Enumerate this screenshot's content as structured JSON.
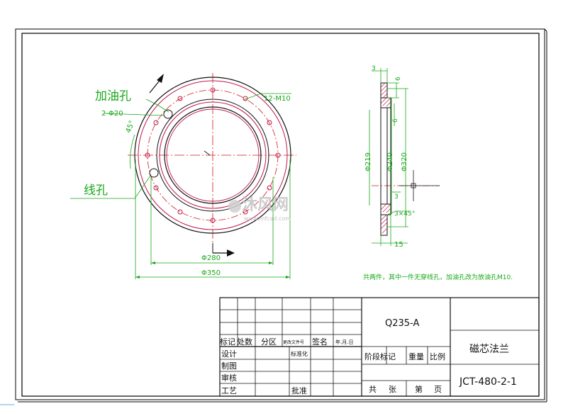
{
  "drawing": {
    "labels": {
      "oil_hole": "加油孔",
      "wire_hole": "线孔",
      "hole_2": "2-Φ20",
      "hole_12": "12-M10",
      "angle": "45°",
      "d280": "Φ280",
      "d350": "Φ350",
      "d219": "Φ219",
      "d240": "Φ240",
      "d320": "Φ320",
      "dim_3_top": "3",
      "dim_6_top": "6",
      "dim_6_mid": "6",
      "dim_3_mid": "3",
      "dim_chamfer": "3×45°",
      "dim_15": "15"
    },
    "note": "共两件，其中一件无穿线孔，加油孔改为放油孔M10.",
    "watermark": {
      "name": "沐风网",
      "url": "www.mfcad.com"
    }
  },
  "title_block": {
    "material": "Q235-A",
    "part_name": "磁芯法兰",
    "drawing_no": "JCT-480-2-1",
    "row_labels": {
      "mark": "标记",
      "count": "处数",
      "zone": "分区",
      "change_doc": "更改文件号",
      "sign": "签名",
      "date": "年.月.日",
      "design": "设计",
      "standard": "标准化",
      "draft": "制图",
      "review": "审核",
      "process": "工艺",
      "approve": "批准"
    },
    "stage_mark": "阶段标记",
    "weight": "重量",
    "scale": "比例",
    "total": "共",
    "sheets": "张",
    "sheet_no": "第",
    "page": "页"
  }
}
